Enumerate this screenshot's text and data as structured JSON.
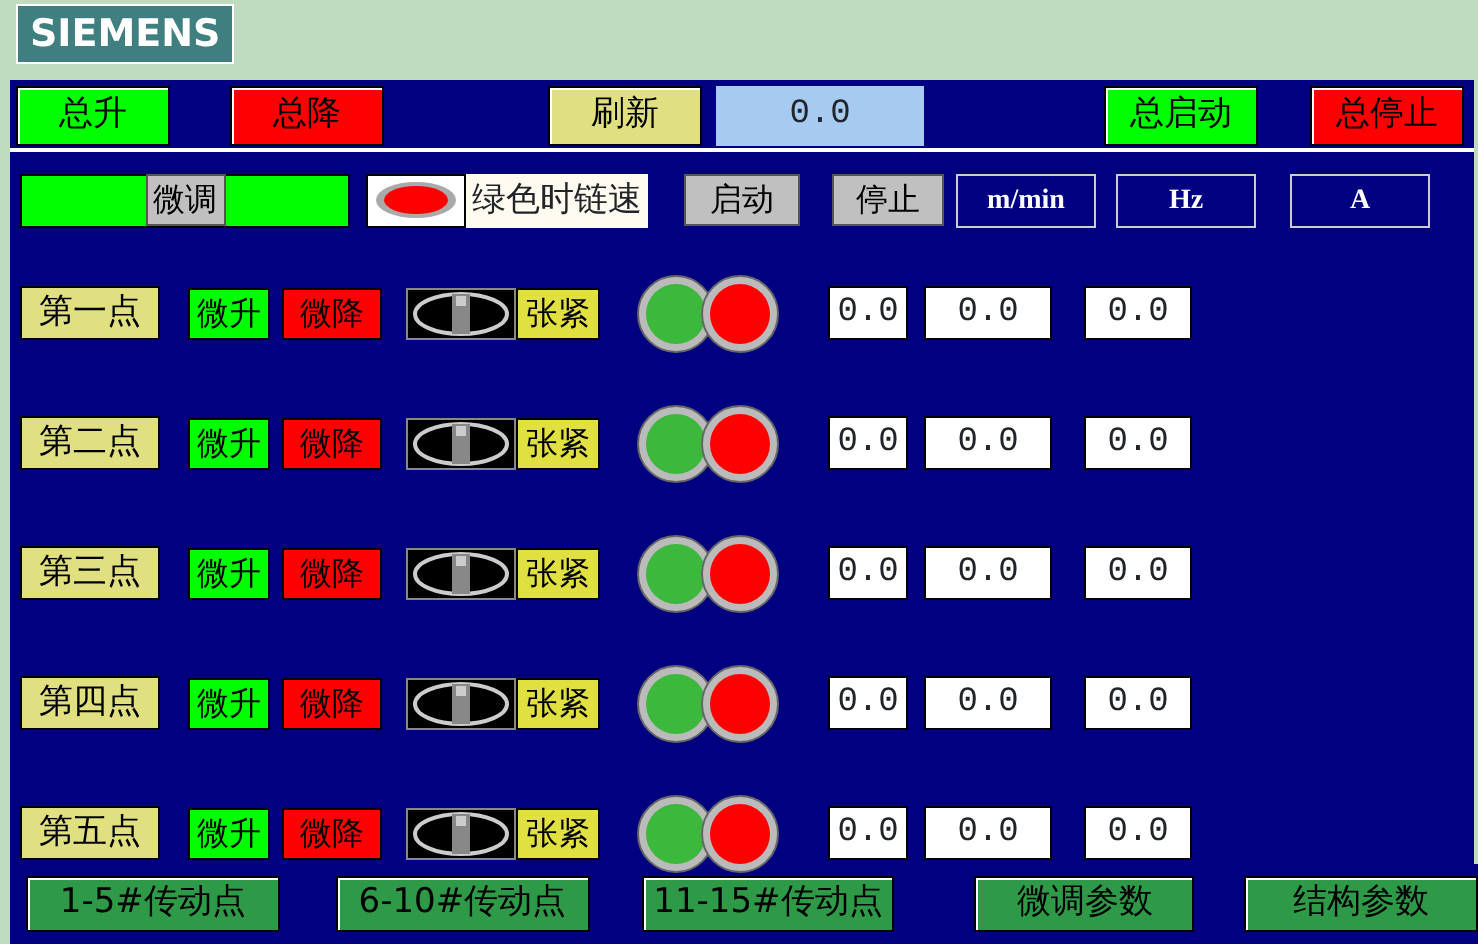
{
  "logo": "SIEMENS",
  "top_bar": {
    "buttons_left": [
      {
        "label": "总升",
        "color": "#00ff00"
      },
      {
        "label": "总降",
        "color": "#ff0000"
      },
      {
        "label": "刷新",
        "color": "#e0e080"
      }
    ],
    "display": "0.0",
    "buttons_right": [
      {
        "label": "总启动",
        "color": "#00ff00"
      },
      {
        "label": "总停止",
        "color": "#ff0000"
      }
    ]
  },
  "controls": {
    "fine_adjust": "微调",
    "chain_speed_toggle": {
      "label": "绿色时链速",
      "on": false
    },
    "start": "启动",
    "stop": "停止",
    "columns": [
      "m/min",
      "Hz",
      "A"
    ]
  },
  "points": [
    {
      "label": "第一点",
      "raise": "微升",
      "lower": "微降",
      "tension": "张紧",
      "lamps": [
        {
          "color": "#3cb83c"
        },
        {
          "color": "#ff0000"
        }
      ],
      "values": [
        "0.0",
        "0.0",
        "0.0"
      ]
    },
    {
      "label": "第二点",
      "raise": "微升",
      "lower": "微降",
      "tension": "张紧",
      "lamps": [
        {
          "color": "#3cb83c"
        },
        {
          "color": "#ff0000"
        }
      ],
      "values": [
        "0.0",
        "0.0",
        "0.0"
      ]
    },
    {
      "label": "第三点",
      "raise": "微升",
      "lower": "微降",
      "tension": "张紧",
      "lamps": [
        {
          "color": "#3cb83c"
        },
        {
          "color": "#ff0000"
        }
      ],
      "values": [
        "0.0",
        "0.0",
        "0.0"
      ]
    },
    {
      "label": "第四点",
      "raise": "微升",
      "lower": "微降",
      "tension": "张紧",
      "lamps": [
        {
          "color": "#3cb83c"
        },
        {
          "color": "#ff0000"
        }
      ],
      "values": [
        "0.0",
        "0.0",
        "0.0"
      ]
    },
    {
      "label": "第五点",
      "raise": "微升",
      "lower": "微降",
      "tension": "张紧",
      "lamps": [
        {
          "color": "#3cb83c"
        },
        {
          "color": "#ff0000"
        }
      ],
      "values": [
        "0.0",
        "0.0",
        "0.0"
      ]
    }
  ],
  "nav": [
    "1-5#传动点",
    "6-10#传动点",
    "11-15#传动点",
    "微调参数",
    "结构参数"
  ]
}
